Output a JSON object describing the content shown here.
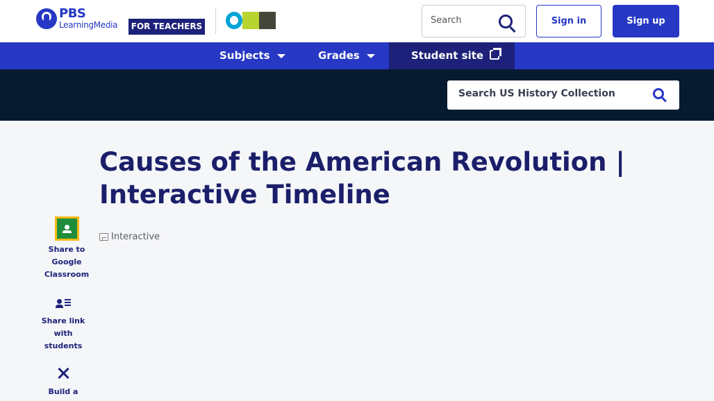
{
  "header": {
    "logo_pbs": "PBS",
    "logo_lm": "LearningMedia",
    "teachers_badge": "FOR TEACHERS",
    "partner_logo": "OPB",
    "search_placeholder": "Search",
    "signin_label": "Sign in",
    "signup_label": "Sign up"
  },
  "nav": {
    "subjects": "Subjects",
    "grades": "Grades",
    "student_site": "Student site"
  },
  "collection": {
    "search_placeholder": "Search US History Collection"
  },
  "main": {
    "title": "Causes of the American Revolution | Interactive Timeline",
    "media_type": "Interactive"
  },
  "share": {
    "google_classroom": "Share to Google Classroom",
    "share_students": "Share link with students",
    "build": "Build a"
  },
  "colors": {
    "brand_blue": "#2638c4",
    "navy": "#1d2179",
    "band_dark": "#061a30"
  }
}
